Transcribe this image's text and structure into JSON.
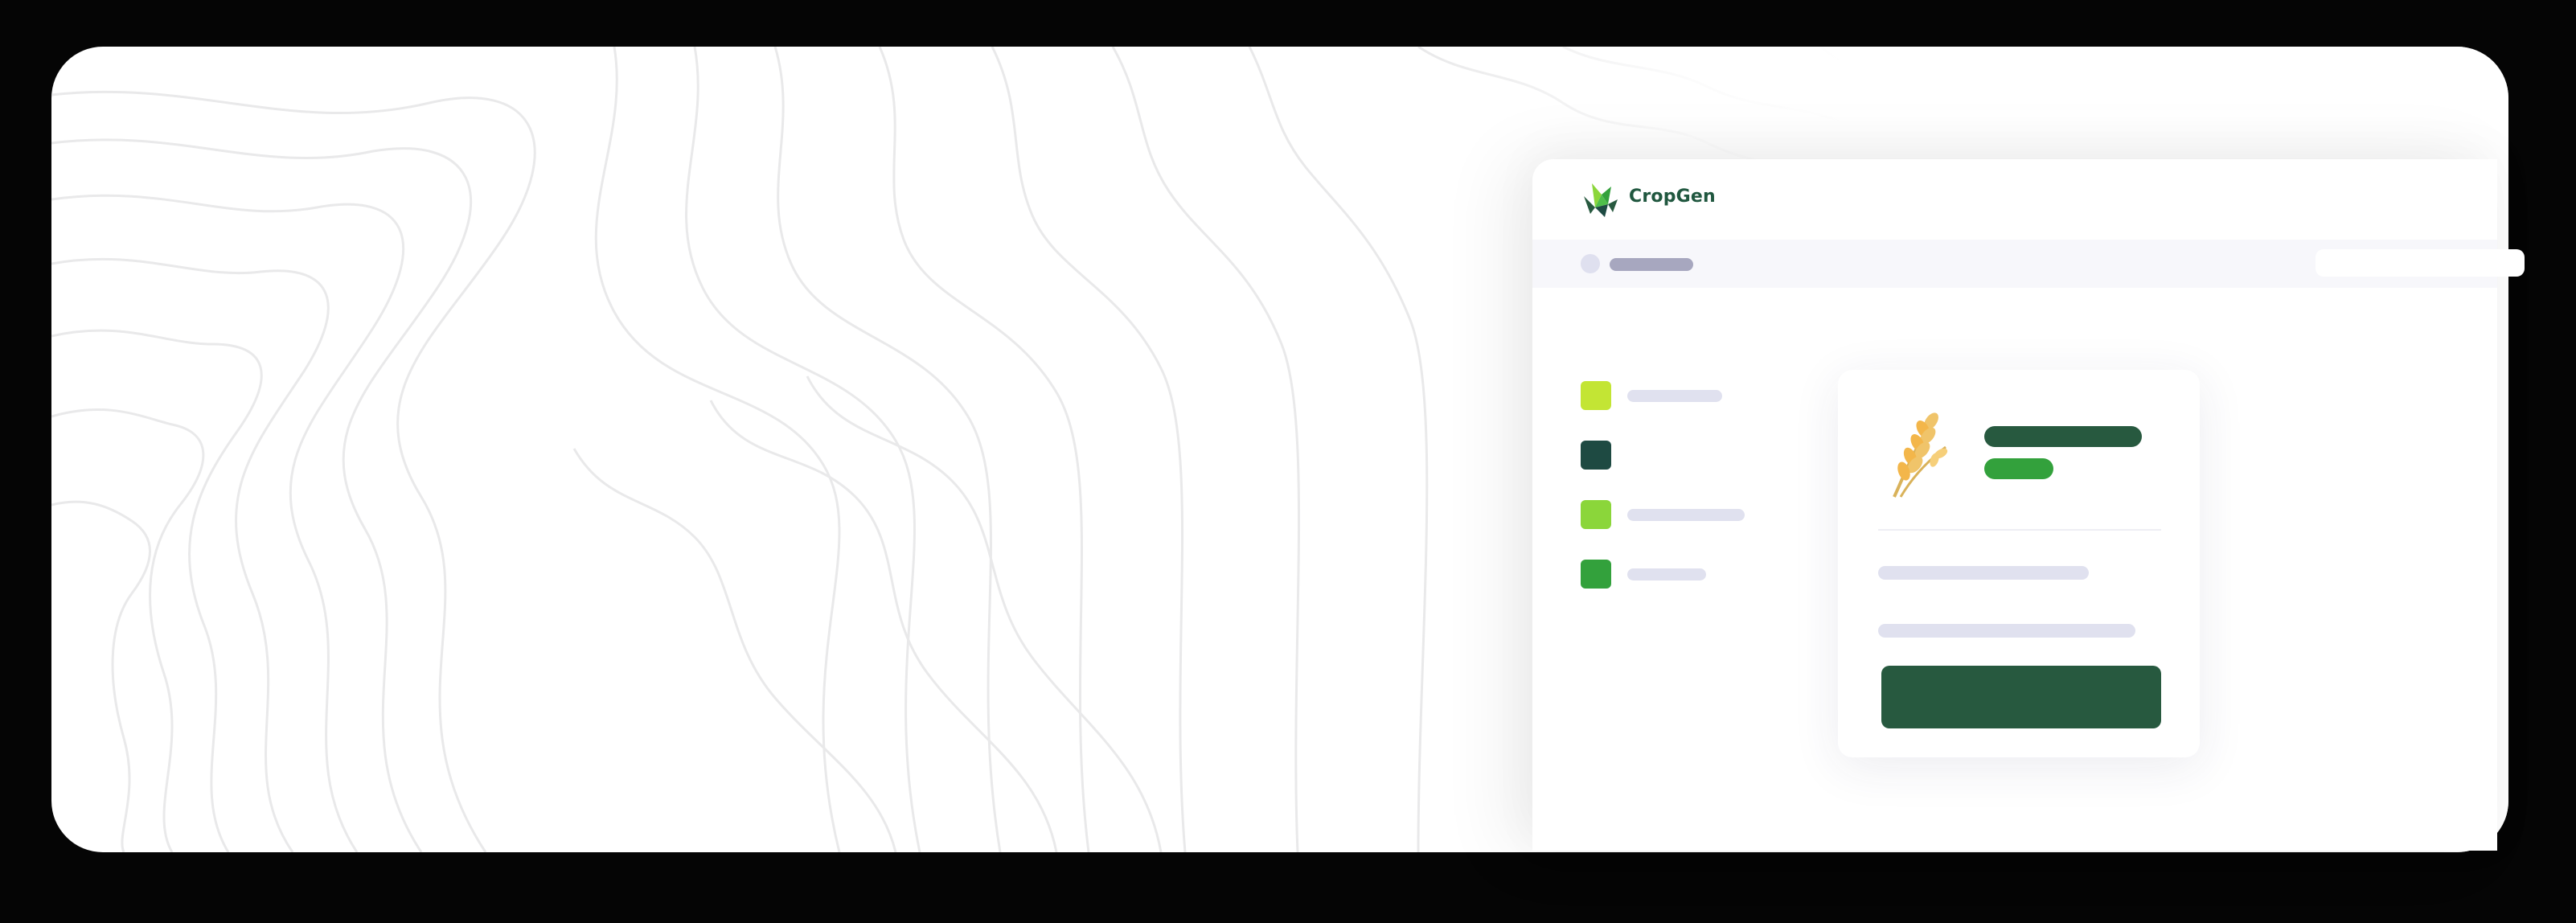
{
  "app": {
    "brand_name": "CropGen",
    "logo_icon": "cropgen-leaf-logo-icon",
    "crop_icon": "wheat-icon"
  },
  "colors": {
    "brand_dark_green": "#27593f",
    "brand_green": "#33a13c",
    "nav_icons": [
      "#c3e534",
      "#1e4a42",
      "#8bd63a",
      "#33a13c"
    ],
    "placeholder_gray": "#e0e1ef",
    "wheat_gold": "#f0c46a"
  },
  "sidebar": {
    "items": [
      {
        "icon": "nav-item-icon-1",
        "color": "#c3e534"
      },
      {
        "icon": "nav-item-icon-2",
        "color": "#1e4a42"
      },
      {
        "icon": "nav-item-icon-3",
        "color": "#8bd63a"
      },
      {
        "icon": "nav-item-icon-4",
        "color": "#33a13c"
      }
    ]
  }
}
